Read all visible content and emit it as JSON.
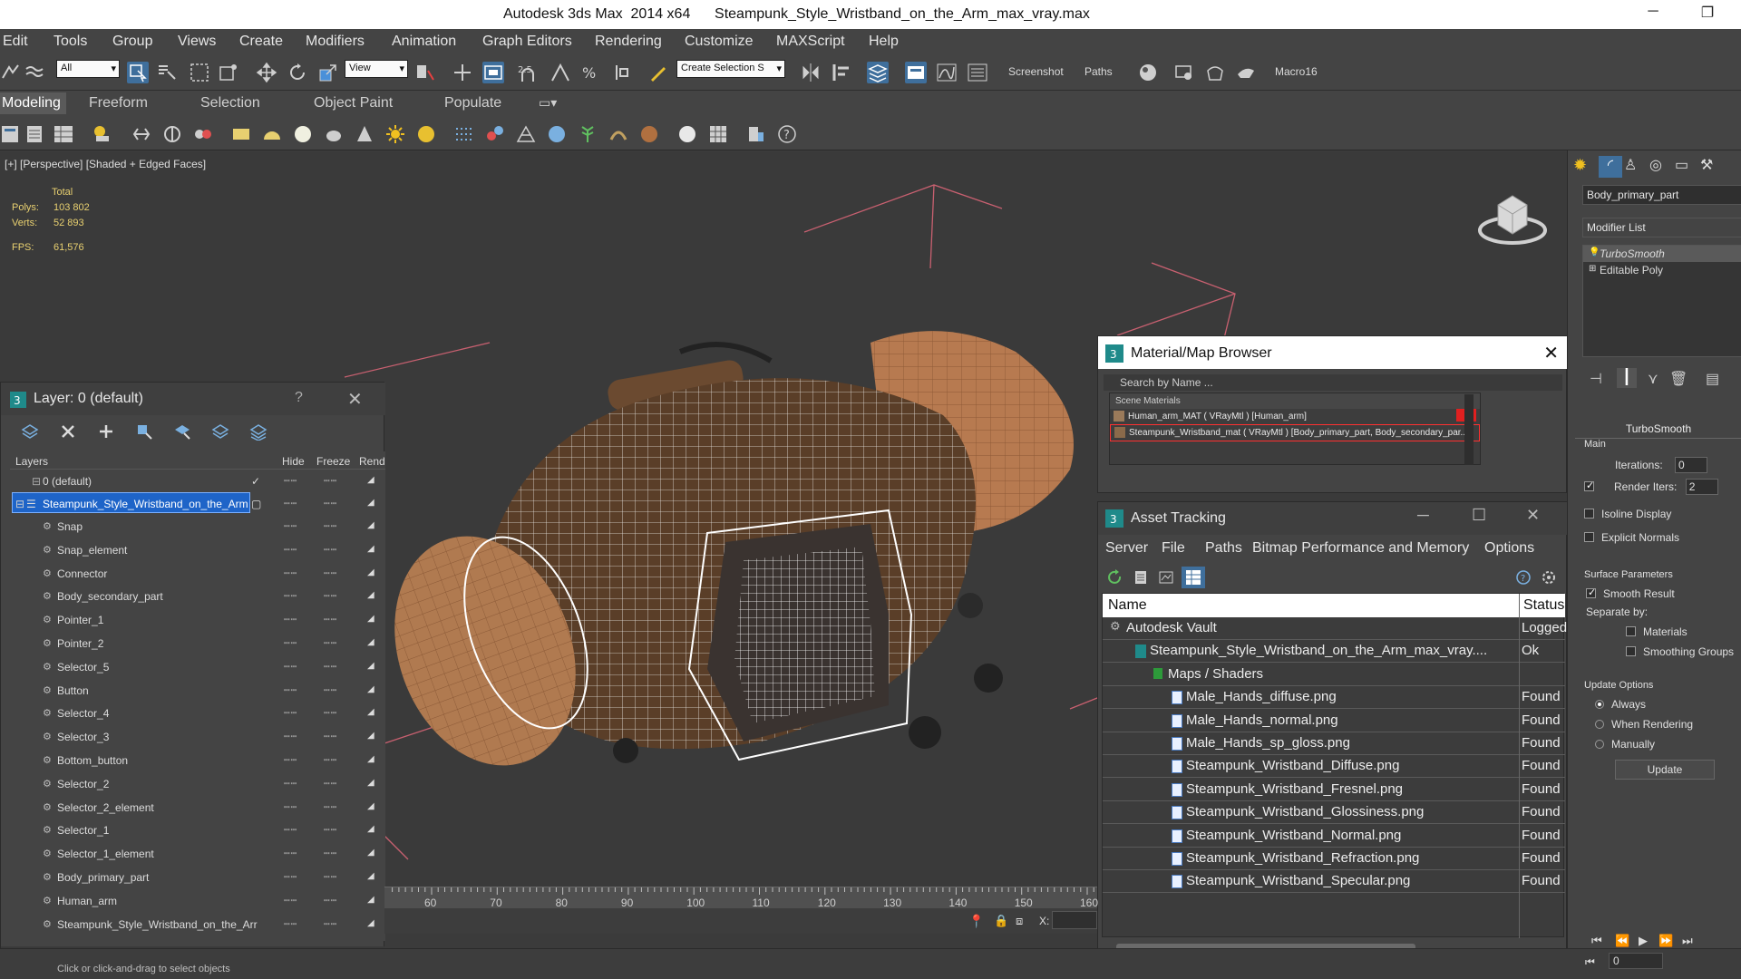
{
  "window": {
    "title": "Autodesk 3ds Max  2014 x64      Steampunk_Style_Wristband_on_the_Arm_max_vray.max",
    "minimize": "─",
    "restore": "❐"
  },
  "menu": [
    "Edit",
    "Tools",
    "Group",
    "Views",
    "Create",
    "Modifiers",
    "Animation",
    "Graph Editors",
    "Rendering",
    "Customize",
    "MAXScript",
    "Help"
  ],
  "toolbar": {
    "filter_value": "All",
    "coord_value": "View",
    "snap_label": "2.5",
    "selection_set_placeholder": "Create Selection S",
    "screenshot_label": "Screenshot",
    "paths_label": "Paths",
    "macro_label": "Macro16"
  },
  "ribbon": {
    "tabs": [
      "Modeling",
      "Freeform",
      "Selection",
      "Object Paint",
      "Populate"
    ]
  },
  "viewport": {
    "label": "[+] [Perspective] [Shaded + Edged Faces]",
    "stats": {
      "total_label": "Total",
      "polys_label": "Polys:",
      "polys_value": "103 802",
      "verts_label": "Verts:",
      "verts_value": "52 893",
      "fps_label": "FPS:",
      "fps_value": "61,576"
    }
  },
  "timeline": {
    "ticks": [
      "60",
      "70",
      "80",
      "90",
      "100",
      "110",
      "120",
      "130",
      "140",
      "150",
      "160"
    ],
    "x_label": "X:"
  },
  "layers": {
    "title": "Layer: 0 (default)",
    "help": "?",
    "columns": {
      "name": "Layers",
      "hide": "Hide",
      "freeze": "Freeze",
      "render": "Rend"
    },
    "rows": [
      {
        "name": "0 (default)",
        "level": 1
      },
      {
        "name": "Steampunk_Style_Wristband_on_the_Arm",
        "level": 1
      },
      {
        "name": "Snap",
        "level": 2
      },
      {
        "name": "Snap_element",
        "level": 2
      },
      {
        "name": "Connector",
        "level": 2
      },
      {
        "name": "Body_secondary_part",
        "level": 2
      },
      {
        "name": "Pointer_1",
        "level": 2
      },
      {
        "name": "Pointer_2",
        "level": 2
      },
      {
        "name": "Selector_5",
        "level": 2
      },
      {
        "name": "Button",
        "level": 2
      },
      {
        "name": "Selector_4",
        "level": 2
      },
      {
        "name": "Selector_3",
        "level": 2
      },
      {
        "name": "Bottom_button",
        "level": 2
      },
      {
        "name": "Selector_2",
        "level": 2
      },
      {
        "name": "Selector_2_element",
        "level": 2
      },
      {
        "name": "Selector_1",
        "level": 2
      },
      {
        "name": "Selector_1_element",
        "level": 2
      },
      {
        "name": "Body_primary_part",
        "level": 2
      },
      {
        "name": "Human_arm",
        "level": 2
      },
      {
        "name": "Steampunk_Style_Wristband_on_the_Arr",
        "level": 2
      }
    ],
    "dots": "┅┅"
  },
  "material_browser": {
    "title": "Material/Map Browser",
    "search_placeholder": "Search by Name ...",
    "group_label": "Scene Materials",
    "items": [
      "Human_arm_MAT ( VRayMtl ) [Human_arm]",
      "Steampunk_Wristband_mat ( VRayMtl ) [Body_primary_part, Body_secondary_par..."
    ]
  },
  "asset_tracking": {
    "title": "Asset Tracking",
    "menu": [
      "Server",
      "File",
      "Paths",
      "Bitmap Performance and Memory",
      "Options"
    ],
    "columns": {
      "name": "Name",
      "status": "Status"
    },
    "rows": [
      {
        "name": "Autodesk Vault",
        "status": "Logged",
        "level": 0
      },
      {
        "name": "Steampunk_Style_Wristband_on_the_Arm_max_vray....",
        "status": "Ok",
        "level": 1
      },
      {
        "name": "Maps / Shaders",
        "status": "",
        "level": 2
      },
      {
        "name": "Male_Hands_diffuse.png",
        "status": "Found",
        "level": 3
      },
      {
        "name": "Male_Hands_normal.png",
        "status": "Found",
        "level": 3
      },
      {
        "name": "Male_Hands_sp_gloss.png",
        "status": "Found",
        "level": 3
      },
      {
        "name": "Steampunk_Wristband_Diffuse.png",
        "status": "Found",
        "level": 3
      },
      {
        "name": "Steampunk_Wristband_Fresnel.png",
        "status": "Found",
        "level": 3
      },
      {
        "name": "Steampunk_Wristband_Glossiness.png",
        "status": "Found",
        "level": 3
      },
      {
        "name": "Steampunk_Wristband_Normal.png",
        "status": "Found",
        "level": 3
      },
      {
        "name": "Steampunk_Wristband_Refraction.png",
        "status": "Found",
        "level": 3
      },
      {
        "name": "Steampunk_Wristband_Specular.png",
        "status": "Found",
        "level": 3
      }
    ]
  },
  "command_panel": {
    "object_name": "Body_primary_part",
    "modifier_list": "Modifier List",
    "stack": [
      "TurboSmooth",
      "Editable Poly"
    ],
    "rollout_title": "TurboSmooth",
    "main_label": "Main",
    "iterations_label": "Iterations:",
    "iterations_value": "0",
    "render_iters_label": "Render Iters:",
    "render_iters_value": "2",
    "isoline_label": "Isoline Display",
    "explicit_normals_label": "Explicit Normals",
    "surface_params_label": "Surface Parameters",
    "smooth_result_label": "Smooth Result",
    "separate_by_label": "Separate by:",
    "materials_label": "Materials",
    "smoothing_groups_label": "Smoothing Groups",
    "update_options_label": "Update Options",
    "always_label": "Always",
    "when_rendering_label": "When Rendering",
    "manually_label": "Manually",
    "update_button": "Update",
    "frame_value": "0"
  },
  "status": {
    "prompt": "Click or click-and-drag to select objects"
  },
  "colors": {
    "accent": "#1e64c8",
    "panel": "#444444",
    "viewport": "#3a3a3a",
    "stats": "#e8d070"
  }
}
